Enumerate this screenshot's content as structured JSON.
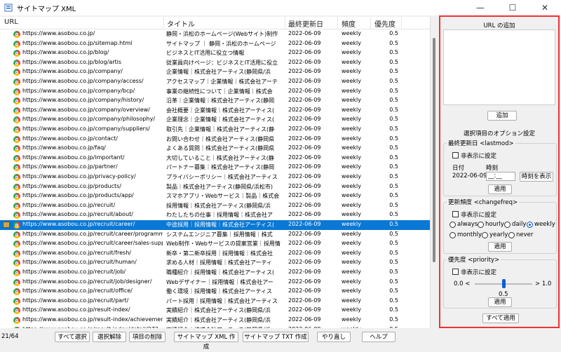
{
  "window": {
    "title": "サイトマップ XML",
    "minimize": "—",
    "maximize": "☐",
    "close": "✕"
  },
  "columns": {
    "url": "URL",
    "title": "タイトル",
    "date": "最終更新日",
    "freq": "頻度",
    "priority": "優先度"
  },
  "rows": [
    {
      "url": "https://www.asobou.co.jp/",
      "title": "静岡・浜松のホームページ(Webサイト)制作",
      "date": "2022-06-09",
      "freq": "weekly",
      "priority": "0.5"
    },
    {
      "url": "https://www.asobou.co.jp/sitemap.html",
      "title": "サイトマップ ｜ 静岡・浜松のホームページ",
      "date": "2022-06-09",
      "freq": "weekly",
      "priority": "0.5"
    },
    {
      "url": "https://www.asobou.co.jp/blog/",
      "title": "ビジネスとIT活用に役立つ情報",
      "date": "2022-06-09",
      "freq": "weekly",
      "priority": "0.5"
    },
    {
      "url": "https://www.asobou.co.jp/blog/artis",
      "title": "従業員向けページ：ビジネスとIT活用に役立",
      "date": "2022-06-09",
      "freq": "weekly",
      "priority": "0.5"
    },
    {
      "url": "https://www.asobou.co.jp/company/",
      "title": "企業情報｜株式会社アーティス(静岡県/浜",
      "date": "2022-06-09",
      "freq": "weekly",
      "priority": "0.5"
    },
    {
      "url": "https://www.asobou.co.jp/company/access/",
      "title": "アクセスマップ｜企業情報｜株式会社アーテ",
      "date": "2022-06-09",
      "freq": "weekly",
      "priority": "0.5"
    },
    {
      "url": "https://www.asobou.co.jp/company/bcp/",
      "title": "事業の継続性について｜企業情報｜株式会",
      "date": "2022-06-09",
      "freq": "weekly",
      "priority": "0.5"
    },
    {
      "url": "https://www.asobou.co.jp/company/history/",
      "title": "沿革｜企業情報｜株式会社アーティス(静岡",
      "date": "2022-06-09",
      "freq": "weekly",
      "priority": "0.5"
    },
    {
      "url": "https://www.asobou.co.jp/company/overview/",
      "title": "会社概要｜企業情報｜株式会社アーティス(",
      "date": "2022-06-09",
      "freq": "weekly",
      "priority": "0.5"
    },
    {
      "url": "https://www.asobou.co.jp/company/philosophy/",
      "title": "企業理念｜企業情報｜株式会社アーティス(",
      "date": "2022-06-09",
      "freq": "weekly",
      "priority": "0.5"
    },
    {
      "url": "https://www.asobou.co.jp/company/suppliers/",
      "title": "取引先｜企業情報｜株式会社アーティス(静",
      "date": "2022-06-09",
      "freq": "weekly",
      "priority": "0.5"
    },
    {
      "url": "https://www.asobou.co.jp/contact/",
      "title": "お問い合わせ｜株式会社アーティス(静岡県",
      "date": "2022-06-09",
      "freq": "weekly",
      "priority": "0.5"
    },
    {
      "url": "https://www.asobou.co.jp/faq/",
      "title": "よくある質問｜株式会社アーティス(静岡県",
      "date": "2022-06-09",
      "freq": "weekly",
      "priority": "0.5"
    },
    {
      "url": "https://www.asobou.co.jp/important/",
      "title": "大切していること｜株式会社アーティス(静",
      "date": "2022-06-09",
      "freq": "weekly",
      "priority": "0.5"
    },
    {
      "url": "https://www.asobou.co.jp/partner/",
      "title": "パートナー募集｜株式会社アーティス(静岡",
      "date": "2022-06-09",
      "freq": "weekly",
      "priority": "0.5"
    },
    {
      "url": "https://www.asobou.co.jp/privacy-policy/",
      "title": "プライバシーポリシー｜株式会社アーティス",
      "date": "2022-06-09",
      "freq": "weekly",
      "priority": "0.5"
    },
    {
      "url": "https://www.asobou.co.jp/products/",
      "title": "製品｜株式会社アーティス(静岡県/浜松市)",
      "date": "2022-06-09",
      "freq": "weekly",
      "priority": "0.5"
    },
    {
      "url": "https://www.asobou.co.jp/products/app/",
      "title": "スマホアプリ・Webサービス｜製品｜株式会",
      "date": "2022-06-09",
      "freq": "weekly",
      "priority": "0.5"
    },
    {
      "url": "https://www.asobou.co.jp/recruit/",
      "title": "採用情報｜株式会社アーティス(静岡県/浜",
      "date": "2022-06-09",
      "freq": "weekly",
      "priority": "0.5"
    },
    {
      "url": "https://www.asobou.co.jp/recruit/about/",
      "title": "わたしたちの仕事｜採用情報｜株式会社ア",
      "date": "2022-06-09",
      "freq": "weekly",
      "priority": "0.5"
    },
    {
      "url": "https://www.asobou.co.jp/recruit/career/",
      "title": "中途採用｜採用情報｜株式会社アーティス(",
      "date": "2022-06-09",
      "freq": "weekly",
      "priority": "0.5",
      "selected": true
    },
    {
      "url": "https://www.asobou.co.jp/recruit/career/programmer/",
      "title": "システムエンジニア募集｜採用情報｜株式",
      "date": "2022-06-09",
      "freq": "weekly",
      "priority": "0.5"
    },
    {
      "url": "https://www.asobou.co.jp/recruit/career/sales-suppo...",
      "title": "Web制作・Webサービスの提案営業｜採用情",
      "date": "2022-06-09",
      "freq": "weekly",
      "priority": "0.5"
    },
    {
      "url": "https://www.asobou.co.jp/recruit/fresh/",
      "title": "新卒・第二新卒採用｜採用情報｜株式会社",
      "date": "2022-06-09",
      "freq": "weekly",
      "priority": "0.5"
    },
    {
      "url": "https://www.asobou.co.jp/recruit/human/",
      "title": "求める人材｜採用情報｜株式会社アーティ",
      "date": "2022-06-09",
      "freq": "weekly",
      "priority": "0.5"
    },
    {
      "url": "https://www.asobou.co.jp/recruit/job/",
      "title": "職種紹介｜採用情報｜株式会社アーティス(",
      "date": "2022-06-09",
      "freq": "weekly",
      "priority": "0.5"
    },
    {
      "url": "https://www.asobou.co.jp/recruit/job/designer/",
      "title": "Webデザイナー｜採用情報｜株式会社アー",
      "date": "2022-06-09",
      "freq": "weekly",
      "priority": "0.5"
    },
    {
      "url": "https://www.asobou.co.jp/recruit/office/",
      "title": "働く環境｜採用情報｜株式会社アーティス",
      "date": "2022-06-09",
      "freq": "weekly",
      "priority": "0.5"
    },
    {
      "url": "https://www.asobou.co.jp/recruit/part/",
      "title": "パート採用｜採用情報｜株式会社アーティス",
      "date": "2022-06-09",
      "freq": "weekly",
      "priority": "0.5"
    },
    {
      "url": "https://www.asobou.co.jp/result-index/",
      "title": "実績紹介｜株式会社アーティス(静岡県/浜",
      "date": "2022-06-09",
      "freq": "weekly",
      "priority": "0.5"
    },
    {
      "url": "https://www.asobou.co.jp/result-index/achievement/",
      "title": "実績紹介｜株式会社アーティス(静岡県/浜",
      "date": "2022-06-09",
      "freq": "weekly",
      "priority": "0.5"
    },
    {
      "url": "https://www.asobou.co.jp/result-index/detail/272",
      "title": "実績紹介｜株式会社アーティス(静岡県/浜",
      "date": "2022-06-09",
      "freq": "weekly",
      "priority": "0.5"
    },
    {
      "url": "https://www.asobou.co.jp/result-index/detail/289",
      "title": "実績紹介｜株式会社アーティス(静岡県/浜",
      "date": "2022-06-09",
      "freq": "weekly",
      "priority": "0.5"
    },
    {
      "url": "https://www.asobou.co.jp/result-index/detail/299",
      "title": "実績紹介｜株式会社アーティス(静岡県/浜",
      "date": "2022-06-09",
      "freq": "weekly",
      "priority": "0.5"
    }
  ],
  "panel": {
    "add_url_title": "URL の追加",
    "add_button": "追加",
    "options_title": "選択項目のオプション設定",
    "lastmod": {
      "group": "最終更新日 <lastmod>",
      "hide": "非表示に設定",
      "date_label": "日付",
      "time_label": "時刻",
      "date_value": "2022-06-09",
      "time_value": "__:__",
      "show_time": "時刻を表示",
      "apply": "適用"
    },
    "changefreq": {
      "group": "更新頻度 <changefreq>",
      "hide": "非表示に設定",
      "options": [
        "always",
        "hourly",
        "daily",
        "weekly",
        "monthly",
        "yearly",
        "never"
      ],
      "selected": "weekly",
      "apply": "適用"
    },
    "priority": {
      "group": "優先度 <priority>",
      "hide": "非表示に設定",
      "min": "0.0 <",
      "max": "> 1.0",
      "value": "0.5",
      "apply": "適用"
    },
    "apply_all": "すべて適用"
  },
  "status": {
    "count": "21/64"
  },
  "bottom_buttons": [
    "すべて選択",
    "選択解除",
    "項目の削除",
    "サイトマップ XML 作成",
    "サイトマップ TXT 作成",
    "やり直し",
    "ヘルプ"
  ]
}
